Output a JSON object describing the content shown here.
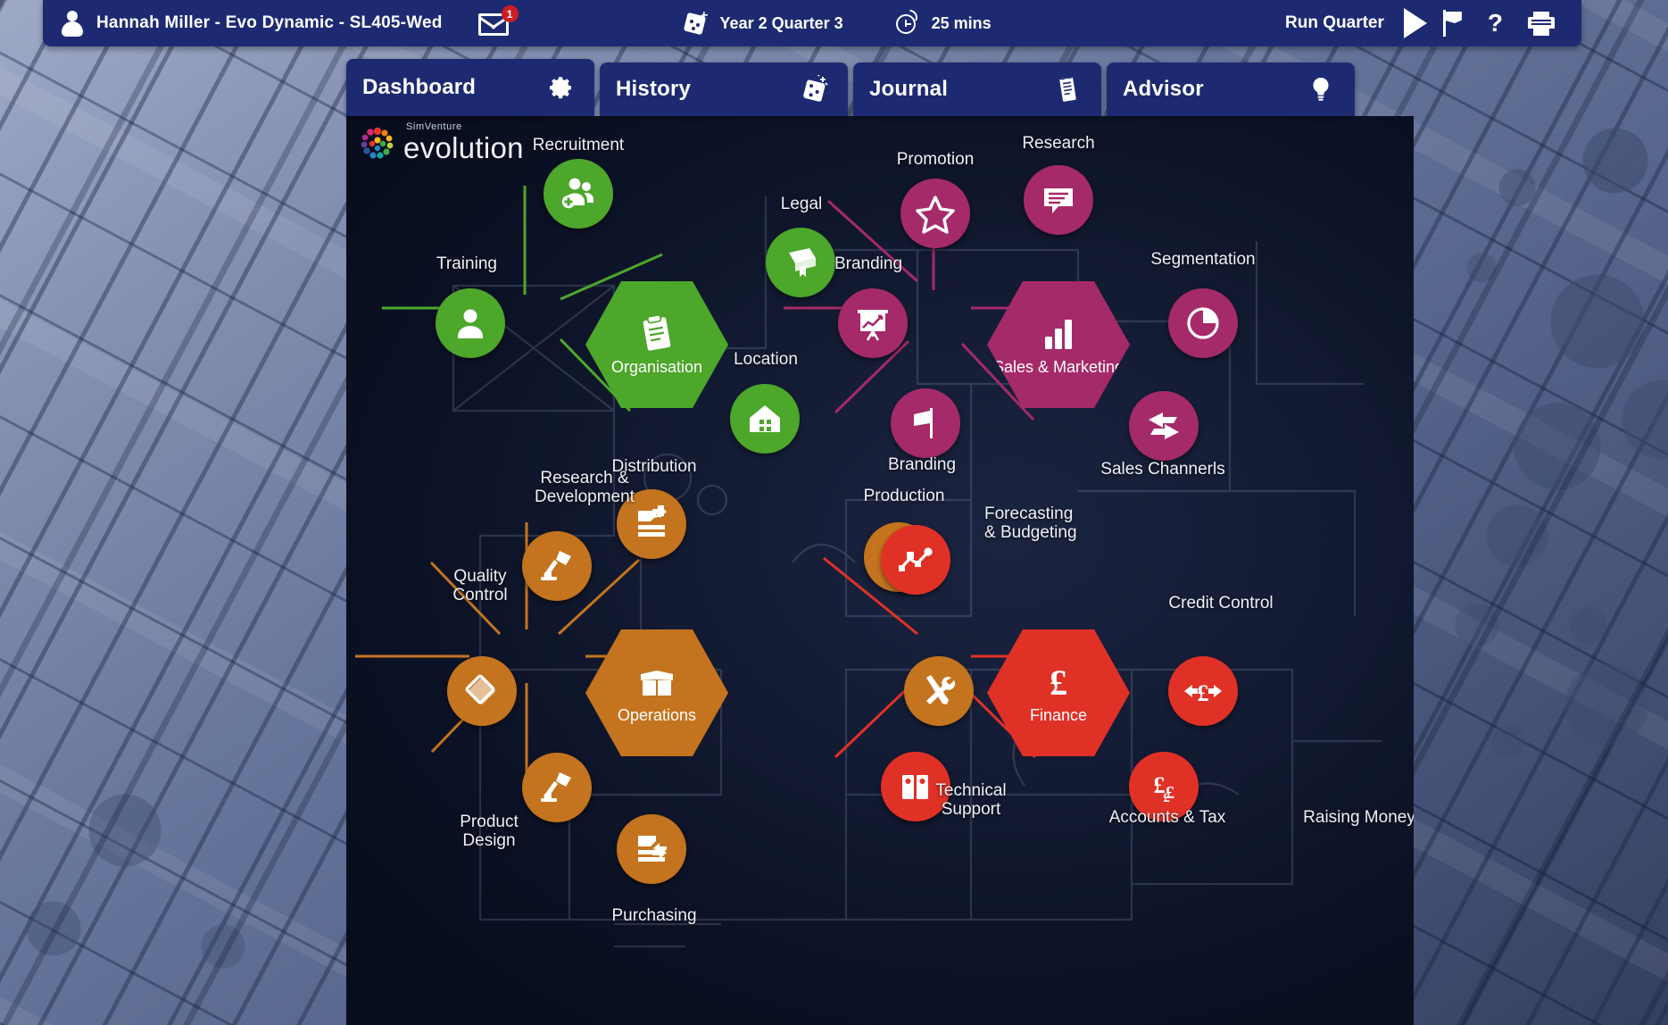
{
  "topbar": {
    "user_icon": "user-avatar-icon",
    "user_text": "Hannah  Miller  -  Evo Dynamic  -  SL405-Wed",
    "mail_icon": "envelope-icon",
    "mail_badge": "1",
    "dice_icon": "dice-icon",
    "quarter_label": "Year 2 Quarter 3",
    "clock_icon": "stopwatch-icon",
    "time_label": "25 mins",
    "run_label": "Run Quarter",
    "play_icon": "play-triangle-icon",
    "flag_icon": "flag-icon",
    "help_icon": "question-mark-icon",
    "print_icon": "printer-icon",
    "bg_color": "#1d2a72"
  },
  "tabs": [
    {
      "label": "Dashboard",
      "icon": "gear-icon",
      "active": true
    },
    {
      "label": "History",
      "icon": "dice-icon",
      "active": false
    },
    {
      "label": "Journal",
      "icon": "notepad-icon",
      "active": false
    },
    {
      "label": "Advisor",
      "icon": "lightbulb-icon",
      "active": false
    }
  ],
  "logo": {
    "brand": "SimVenture",
    "product": "evolution",
    "icon": "colour-dot-wheel-logo"
  },
  "colors": {
    "green": "#4ca72b",
    "pink": "#a52a69",
    "orange": "#c4741e",
    "red": "#e03127",
    "panel_dark": "#0d1428",
    "navy": "#1d2a72"
  },
  "clusters": [
    {
      "name": "organisation",
      "color": "#4ca72b",
      "hub": {
        "label": "Organisation",
        "icon": "clipboard-icon"
      },
      "nodes": [
        {
          "label": "Recruitment",
          "icon": "add-people-icon"
        },
        {
          "label": "Legal",
          "icon": "legal-book-icon"
        },
        {
          "label": "Training",
          "icon": "person-icon"
        },
        {
          "label": "Location",
          "icon": "building-icon"
        }
      ]
    },
    {
      "name": "sales-and-marketing",
      "color": "#a52a69",
      "hub": {
        "label": "Sales &\nMarketing",
        "icon": "bar-chart-icon"
      },
      "nodes": [
        {
          "label": "Promotion",
          "icon": "star-icon"
        },
        {
          "label": "Research",
          "icon": "speech-bubble-icon"
        },
        {
          "label": "Branding",
          "icon": "presentation-chart-icon"
        },
        {
          "label": "Segmentation",
          "icon": "pie-chart-icon"
        },
        {
          "label": "Branding",
          "icon": "flag-icon"
        },
        {
          "label": "Sales Channerls",
          "icon": "exchange-arrows-icon"
        }
      ]
    },
    {
      "name": "operations",
      "color": "#c4741e",
      "hub": {
        "label": "Operations",
        "icon": "open-box-icon"
      },
      "nodes": [
        {
          "label": "Distribution",
          "icon": "outbound-document-icon"
        },
        {
          "label": "Research &\nDevelopment",
          "icon": "desk-lamp-icon"
        },
        {
          "label": "Production",
          "icon": "gears-icon"
        },
        {
          "label": "Quality\nControl",
          "icon": "diamond-icon"
        },
        {
          "label": "Technical\nSupport",
          "icon": "tools-icon"
        },
        {
          "label": "Product\nDesign",
          "icon": "desk-lamp-icon"
        },
        {
          "label": "Purchasing",
          "icon": "inbound-document-icon"
        }
      ]
    },
    {
      "name": "finance",
      "color": "#e03127",
      "hub": {
        "label": "Finance",
        "icon": "pound-sign-icon"
      },
      "nodes": [
        {
          "label": "Forecasting\n& Budgeting",
          "icon": "line-graph-icon"
        },
        {
          "label": "Credit Control",
          "icon": "pound-arrows-icon"
        },
        {
          "label": "Accounts & Tax",
          "icon": "ledger-books-icon"
        },
        {
          "label": "Raising Money",
          "icon": "pound-stack-icon"
        }
      ]
    }
  ]
}
